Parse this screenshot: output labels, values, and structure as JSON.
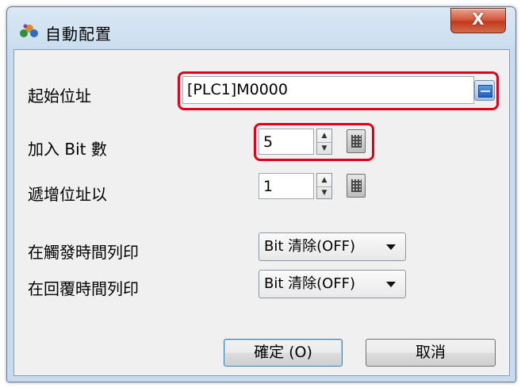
{
  "window": {
    "title": "自動配置",
    "close_label": "X"
  },
  "form": {
    "start_address": {
      "label": "起始位址",
      "value": "[PLC1]M0000"
    },
    "add_bits": {
      "label": "加入 Bit 數",
      "value": "5"
    },
    "increment": {
      "label": "遞增位址以",
      "value": "1"
    },
    "print_on_trigger": {
      "label": "在觸發時間列印",
      "selected": "Bit 清除(OFF)"
    },
    "print_on_recover": {
      "label": "在回覆時間列印",
      "selected": "Bit 清除(OFF)"
    }
  },
  "buttons": {
    "ok": "確定 (O)",
    "cancel": "取消"
  },
  "colors": {
    "highlight": "#e0001e",
    "close_button": "#c8452a",
    "titlebar": "#cddff0"
  }
}
